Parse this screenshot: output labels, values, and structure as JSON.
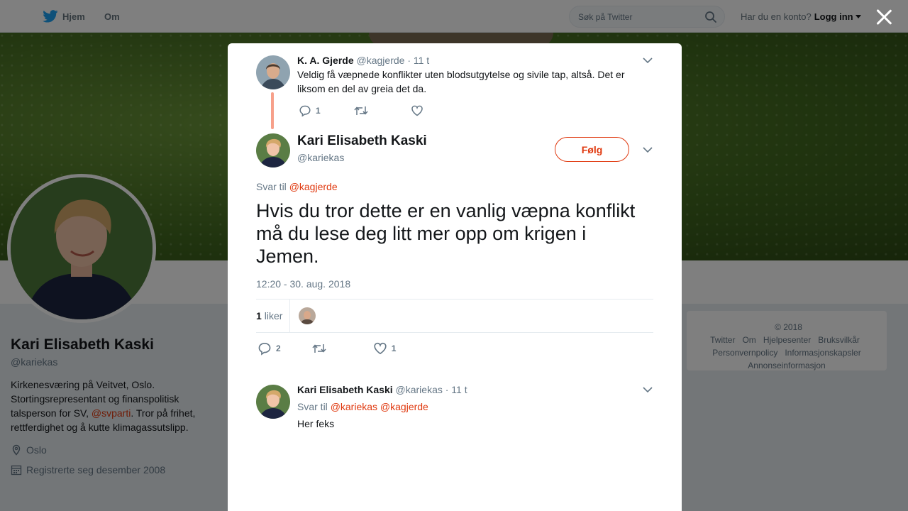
{
  "topbar": {
    "home_label": "Hjem",
    "about_label": "Om",
    "search_placeholder": "Søk på Twitter",
    "account_prompt": "Har du en konto?",
    "login_label": "Logg inn"
  },
  "profile": {
    "name": "Kari Elisabeth Kaski",
    "handle": "@kariekas",
    "bio_part1": "Kirkenesværing på Veitvet, Oslo. Stortingsrepresentant og finanspolitisk talsperson for SV, ",
    "bio_link": "@svparti",
    "bio_part2": ". Tror på frihet, rettferdighet og å kutte klimagassutslipp.",
    "location": "Oslo",
    "joined": "Registrerte seg desember 2008"
  },
  "footer": {
    "links": [
      "© 2018 Twitter",
      "Om",
      "Hjelpesenter",
      "Bruksvilkår",
      "Personvernpolicy",
      "Informasjonskapsler",
      "Annonseinformasjon"
    ]
  },
  "parent_tweet": {
    "name": "K. A. Gjerde",
    "handle": "@kagjerde",
    "time": "· 11 t",
    "text": "Veldig få væpnede konflikter uten blodsutgytelse og sivile tap, altså. Det er liksom en del av greia det da.",
    "reply_count": "1"
  },
  "main_tweet": {
    "name": "Kari Elisabeth Kaski",
    "handle": "@kariekas",
    "follow_label": "Følg",
    "reply_to_label": "Svar til",
    "reply_to_handle": "@kagjerde",
    "text": "Hvis du tror dette er en vanlig væpna konflikt må du lese deg litt mer opp om krigen i Jemen.",
    "timestamp": "12:20 - 30. aug. 2018",
    "likes_count": "1",
    "likes_label": "liker",
    "reply_count": "2",
    "like_count": "1"
  },
  "reply_tweet": {
    "name": "Kari Elisabeth Kaski",
    "handle": "@kariekas",
    "time": "· 11 t",
    "reply_to_label": "Svar til",
    "reply_to_handles": "@kariekas @kagjerde",
    "text": "Her feks"
  },
  "colors": {
    "accent": "#e0380e",
    "thread_line": "#f7a08a",
    "muted": "#657786"
  }
}
